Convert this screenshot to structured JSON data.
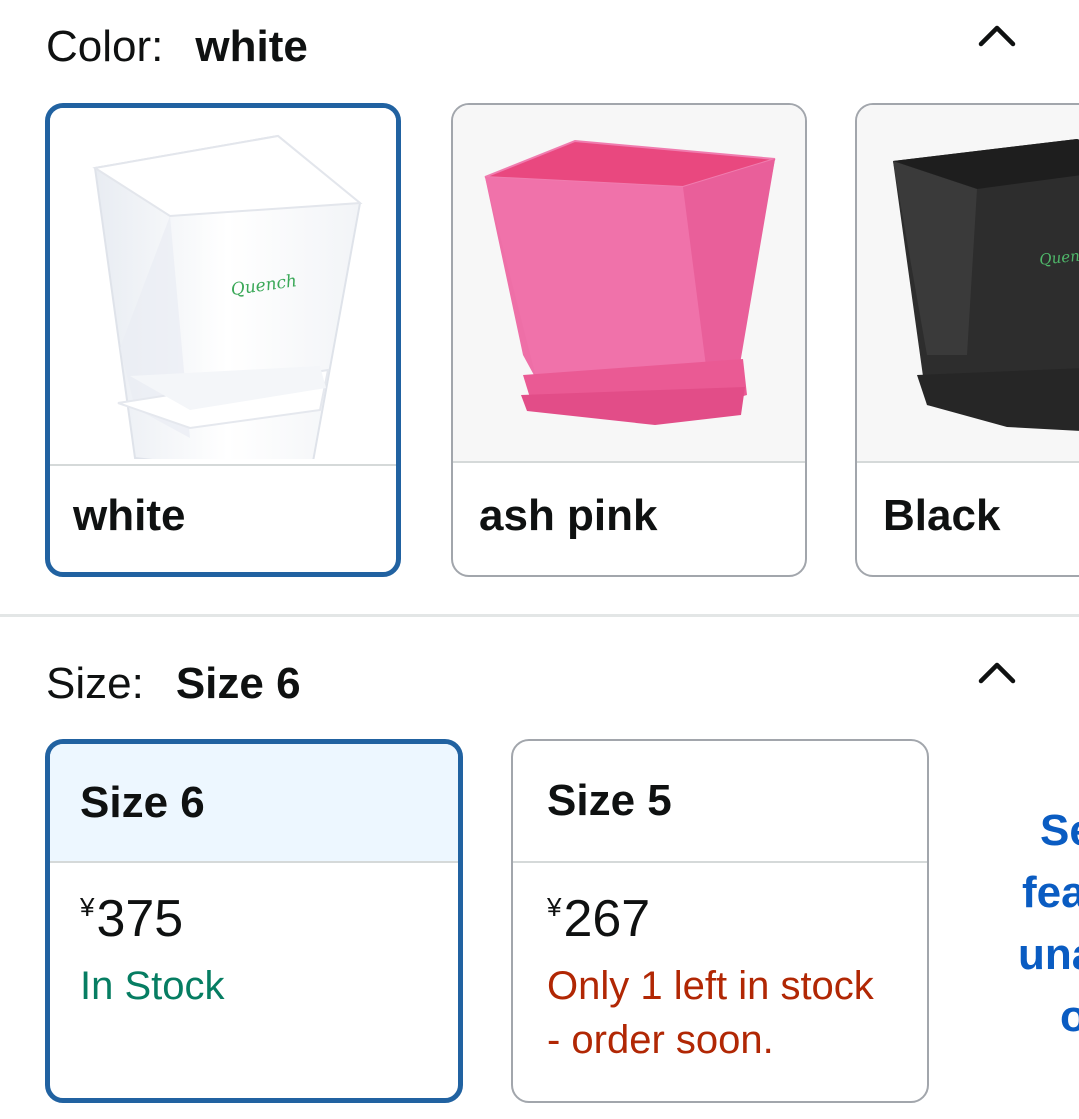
{
  "color": {
    "label": "Color:",
    "selected_value": "white",
    "options": [
      {
        "label": "white",
        "selected": true,
        "pot_color": "#ffffff",
        "brand": "Quench"
      },
      {
        "label": "ash pink",
        "selected": false,
        "pot_color": "#ec6ea5"
      },
      {
        "label": "Black",
        "selected": false,
        "pot_color": "#2b2b2b",
        "brand": "Quen"
      }
    ]
  },
  "size": {
    "label": "Size:",
    "selected_value": "Size 6",
    "options": [
      {
        "label": "Size 6",
        "currency": "¥",
        "price": "375",
        "stock": "In Stock",
        "stock_color": "#067d62",
        "selected": true
      },
      {
        "label": "Size 5",
        "currency": "¥",
        "price": "267",
        "stock_line1": "Only 1 left in stock",
        "stock_line2": "- order soon.",
        "stock_color": "#b12704",
        "selected": false
      }
    ],
    "side_link_lines": [
      "Se",
      "fea",
      "una",
      "o"
    ]
  },
  "colors": {
    "selected_border": "#2162a1",
    "link": "#0a5cc2",
    "in_stock": "#067d62",
    "low_stock": "#b12704"
  },
  "icons": {
    "collapse": "chevron-up-icon"
  }
}
